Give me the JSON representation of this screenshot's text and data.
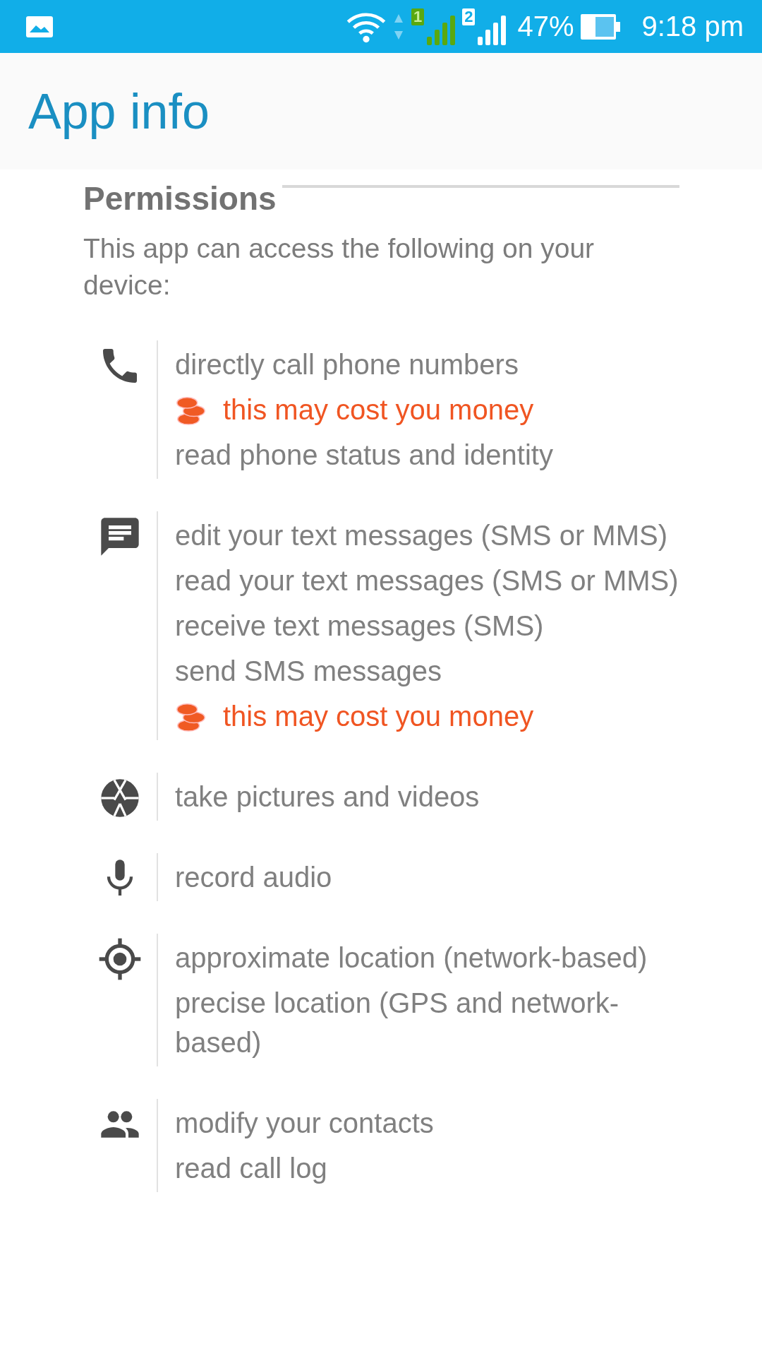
{
  "status_bar": {
    "sims": [
      "1",
      "2"
    ],
    "battery": "47%",
    "time": "9:18 pm"
  },
  "header": {
    "title": "App info"
  },
  "permissions": {
    "heading": "Permissions",
    "description": "This app can access the following on your device:",
    "groups": [
      {
        "kind": "phone",
        "items": [
          {
            "kind": "permission",
            "text": "directly call phone numbers"
          },
          {
            "kind": "cost",
            "text": "this may cost you money"
          },
          {
            "kind": "permission",
            "text": "read phone status and identity"
          }
        ]
      },
      {
        "kind": "message",
        "items": [
          {
            "kind": "permission",
            "text": "edit your text messages (SMS or MMS)"
          },
          {
            "kind": "permission",
            "text": "read your text messages (SMS or MMS)"
          },
          {
            "kind": "permission",
            "text": "receive text messages (SMS)"
          },
          {
            "kind": "permission",
            "text": "send SMS messages"
          },
          {
            "kind": "cost",
            "text": "this may cost you money"
          }
        ]
      },
      {
        "kind": "camera",
        "items": [
          {
            "kind": "permission",
            "text": "take pictures and videos"
          }
        ]
      },
      {
        "kind": "microphone",
        "items": [
          {
            "kind": "permission",
            "text": "record audio"
          }
        ]
      },
      {
        "kind": "location",
        "items": [
          {
            "kind": "permission",
            "text": "approximate location (network-based)"
          },
          {
            "kind": "permission",
            "text": "precise location (GPS and network-based)"
          }
        ]
      },
      {
        "kind": "contacts",
        "items": [
          {
            "kind": "permission",
            "text": "modify your contacts"
          },
          {
            "kind": "permission",
            "text": "read call log"
          }
        ]
      }
    ]
  }
}
